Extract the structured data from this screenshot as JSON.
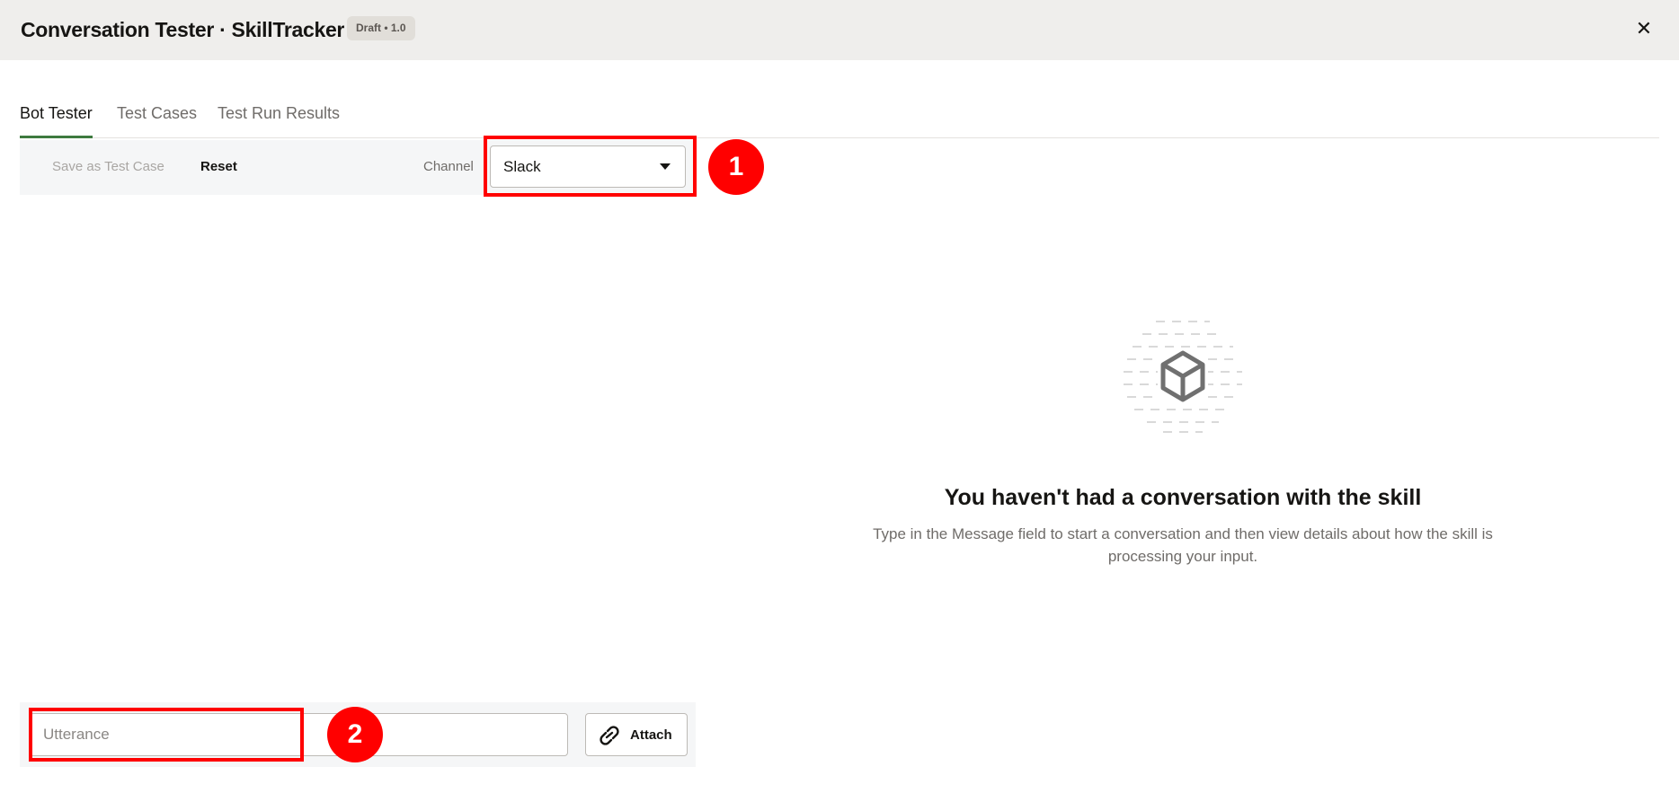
{
  "header": {
    "title": "Conversation Tester · SkillTracker",
    "badge": "Draft • 1.0",
    "close_icon": "close-icon"
  },
  "tabs": [
    {
      "label": "Bot Tester",
      "active": true
    },
    {
      "label": "Test Cases",
      "active": false
    },
    {
      "label": "Test Run Results",
      "active": false
    }
  ],
  "toolbar": {
    "save_label": "Save as Test Case",
    "reset_label": "Reset",
    "channel_label": "Channel",
    "channel_value": "Slack"
  },
  "empty_state": {
    "icon": "cube-icon",
    "title": "You haven't had a conversation with the skill",
    "subtitle": "Type in the Message field to start a conversation and then view details about how the skill is processing your input."
  },
  "composer": {
    "placeholder": "Utterance",
    "attach_label": "Attach",
    "attach_icon": "link-icon"
  },
  "annotations": {
    "marker_1": "1",
    "marker_2": "2",
    "color": "#ff0000"
  }
}
